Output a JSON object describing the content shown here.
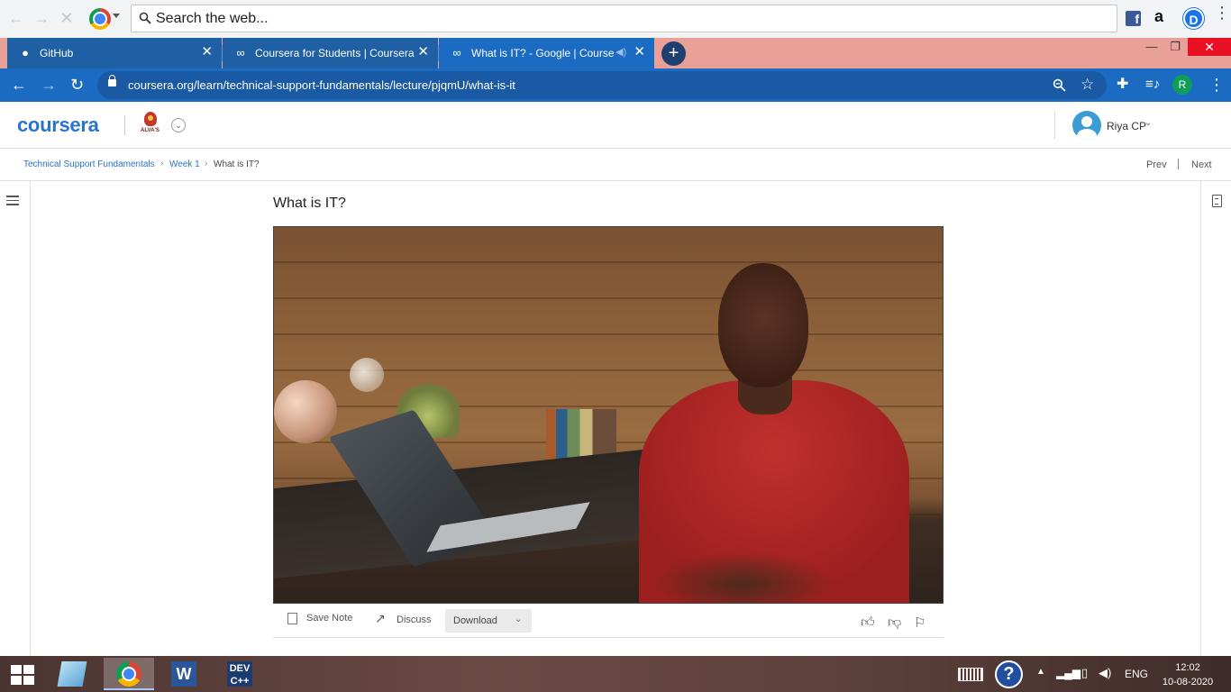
{
  "browser": {
    "search_placeholder": "Search the web...",
    "extensions": {
      "facebook": "f",
      "amazon": "a",
      "profile_top": "D"
    },
    "tabs": [
      {
        "label": "GitHub",
        "icon": "github-icon"
      },
      {
        "label": "Coursera for Students | Coursera",
        "icon": "coursera-icon"
      },
      {
        "label": "What is IT? - Google | Course",
        "icon": "coursera-icon",
        "active": true
      }
    ],
    "new_tab": "+",
    "url": "coursera.org/learn/technical-support-fundamentals/lecture/pjqmU/what-is-it",
    "profile_initial": "R"
  },
  "coursera": {
    "logo": "coursera",
    "institution_label": "ALVA'S",
    "user_name": "Riya CP",
    "breadcrumbs": [
      "Technical Support Fundamentals",
      "Week 1",
      "What is IT?"
    ],
    "prev": "Prev",
    "next": "Next",
    "lecture_title": "What is IT?",
    "actions": {
      "save_note": "Save Note",
      "discuss": "Discuss",
      "download": "Download"
    }
  },
  "taskbar": {
    "apps": [
      "explorer",
      "chrome",
      "word",
      "devcpp"
    ],
    "word_letter": "W",
    "dev_label_1": "DEV",
    "dev_label_2": "C++",
    "help": "?",
    "language": "ENG",
    "time": "12:02",
    "date": "10-08-2020"
  },
  "colors": {
    "coursera_blue": "#2a73cc",
    "browser_blue": "#1a6bc1",
    "tab_strip": "#e8a098"
  }
}
